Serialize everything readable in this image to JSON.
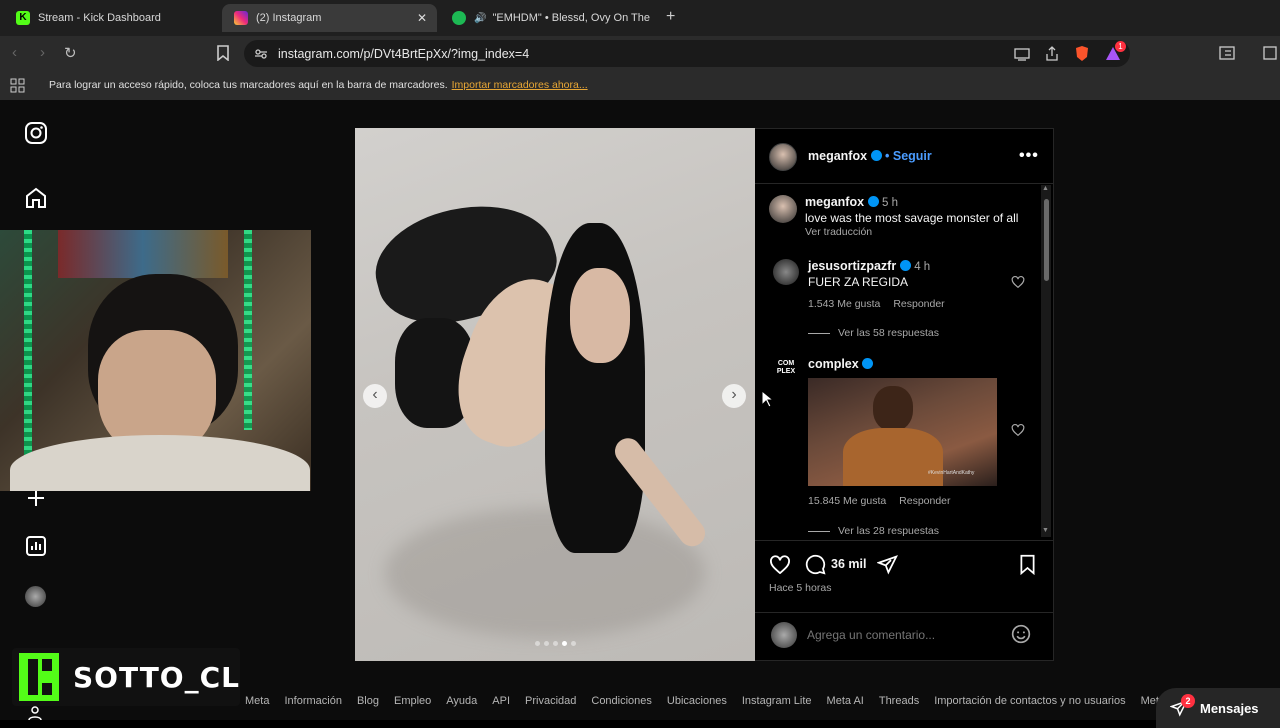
{
  "tabs": [
    {
      "label": "Stream - Kick Dashboard"
    },
    {
      "label": "(2) Instagram"
    },
    {
      "label": "\"EMHDM\" • Blessd, Ovy On The I"
    }
  ],
  "address": {
    "url": "instagram.com/p/DVt4BrtEpXx/?img_index=4"
  },
  "bookmarks": {
    "text": "Para lograr un acceso rápido, coloca tus marcadores aquí en la barra de marcadores.",
    "link": "Importar marcadores ahora..."
  },
  "post": {
    "author": "meganfox",
    "follow": "• Seguir",
    "caption_user": "meganfox",
    "caption_time": "5 h",
    "caption": "love was the most savage monster of all",
    "translate": "Ver traducción",
    "comments": [
      {
        "user": "jesusortizpazfr",
        "time": "4 h",
        "text": "FUER ZA REGIDA",
        "likes": "1.543 Me gusta",
        "reply": "Responder",
        "replies": "Ver las 58 respuestas"
      },
      {
        "user": "complex",
        "avatar_text": "COM PLEX",
        "gif_caption": "#KevinHartAndKathy",
        "likes": "15.845 Me gusta",
        "reply": "Responder",
        "replies": "Ver las 28 respuestas"
      }
    ],
    "comment_count": "36 mil",
    "timestamp": "Hace 5 horas",
    "add_comment_placeholder": "Agrega un comentario...",
    "carousel_dots": 5,
    "carousel_active": 4
  },
  "footer": {
    "links": [
      "Meta",
      "Información",
      "Blog",
      "Empleo",
      "Ayuda",
      "API",
      "Privacidad",
      "Condiciones",
      "Ubicaciones",
      "Instagram Lite",
      "Meta AI",
      "Threads",
      "Importación de contactos y no usuarios",
      "Meta Verifie"
    ]
  },
  "messages": {
    "label": "Mensajes",
    "badge": "2"
  },
  "stream": {
    "name": "SOTTO_CL"
  },
  "brave_badge": "1",
  "colors": {
    "accent": "#0095f6",
    "kick": "#53fc18",
    "badge": "#ff3040"
  }
}
